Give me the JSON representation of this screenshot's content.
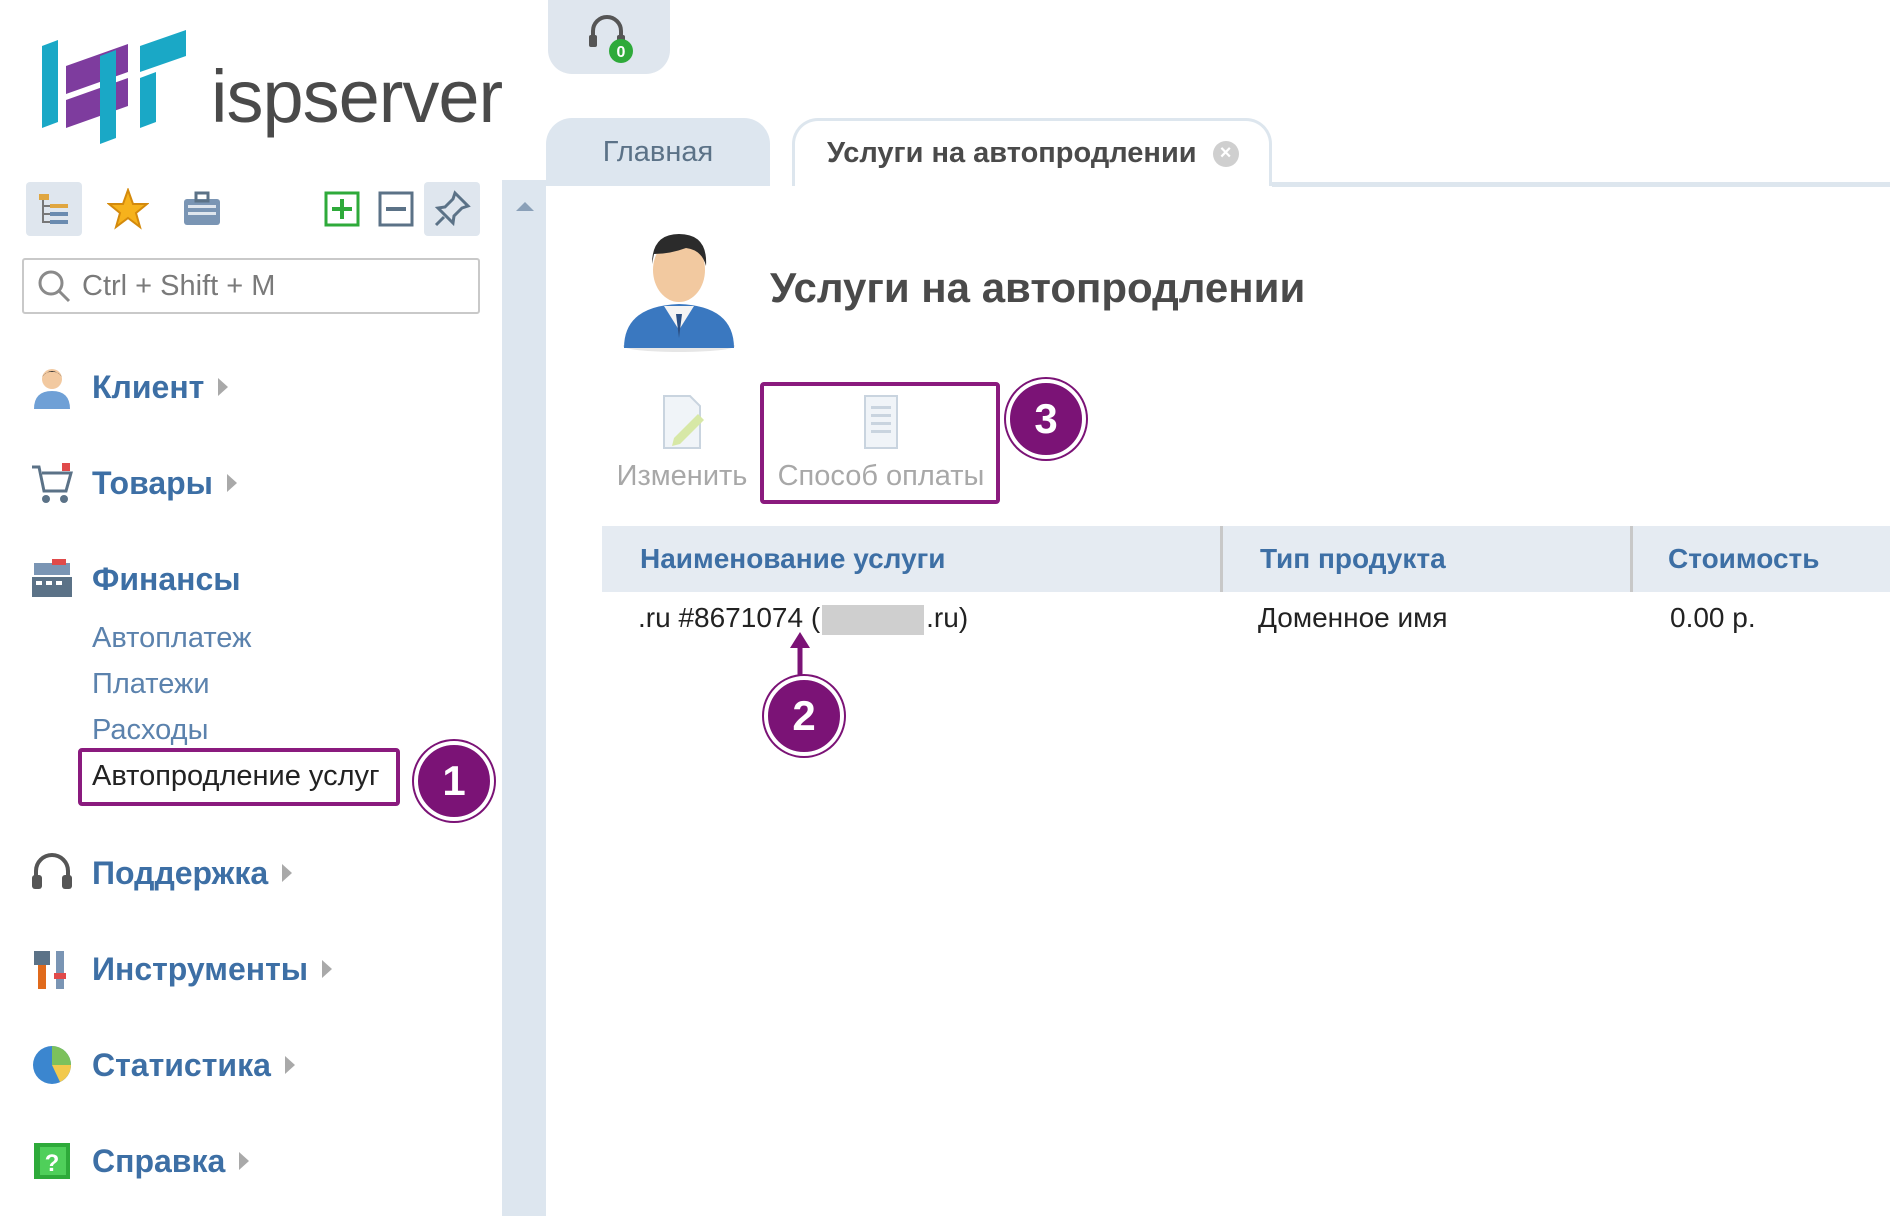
{
  "brand": {
    "logo_text": "ispserver"
  },
  "sidebar": {
    "search_placeholder": "Ctrl + Shift + M",
    "toolbar_icons": [
      "tree-icon",
      "star-icon",
      "clipboard-icon",
      "plus-icon",
      "minus-icon",
      "pin-icon"
    ],
    "menu": [
      {
        "label": "Клиент",
        "icon": "client-icon"
      },
      {
        "label": "Товары",
        "icon": "cart-icon"
      },
      {
        "label": "Финансы",
        "icon": "register-icon"
      },
      {
        "label": "Поддержка",
        "icon": "headset-icon"
      },
      {
        "label": "Инструменты",
        "icon": "tools-icon"
      },
      {
        "label": "Статистика",
        "icon": "pie-icon"
      },
      {
        "label": "Справка",
        "icon": "help-icon"
      }
    ],
    "finance_sub": [
      "Автоплатеж",
      "Платежи",
      "Расходы",
      "Автопродление услуг"
    ]
  },
  "support": {
    "count": "0"
  },
  "tabs": [
    {
      "label": "Главная"
    },
    {
      "label": "Услуги на автопродлении"
    }
  ],
  "page": {
    "title": "Услуги на автопродлении"
  },
  "actions": [
    {
      "label": "Изменить"
    },
    {
      "label": "Способ оплаты"
    }
  ],
  "table": {
    "columns": [
      "Наименование услуги",
      "Тип продукта",
      "Стоимость"
    ],
    "rows": [
      {
        "name_prefix": ".ru #8671074 (",
        "name_suffix": ".ru)",
        "type": "Доменное имя",
        "cost": "0.00 р."
      }
    ]
  },
  "annotations": [
    "1",
    "2",
    "3"
  ],
  "colors": {
    "annotation": "#7b1376",
    "link": "#3d6fa5",
    "panel": "#dde6ee"
  }
}
